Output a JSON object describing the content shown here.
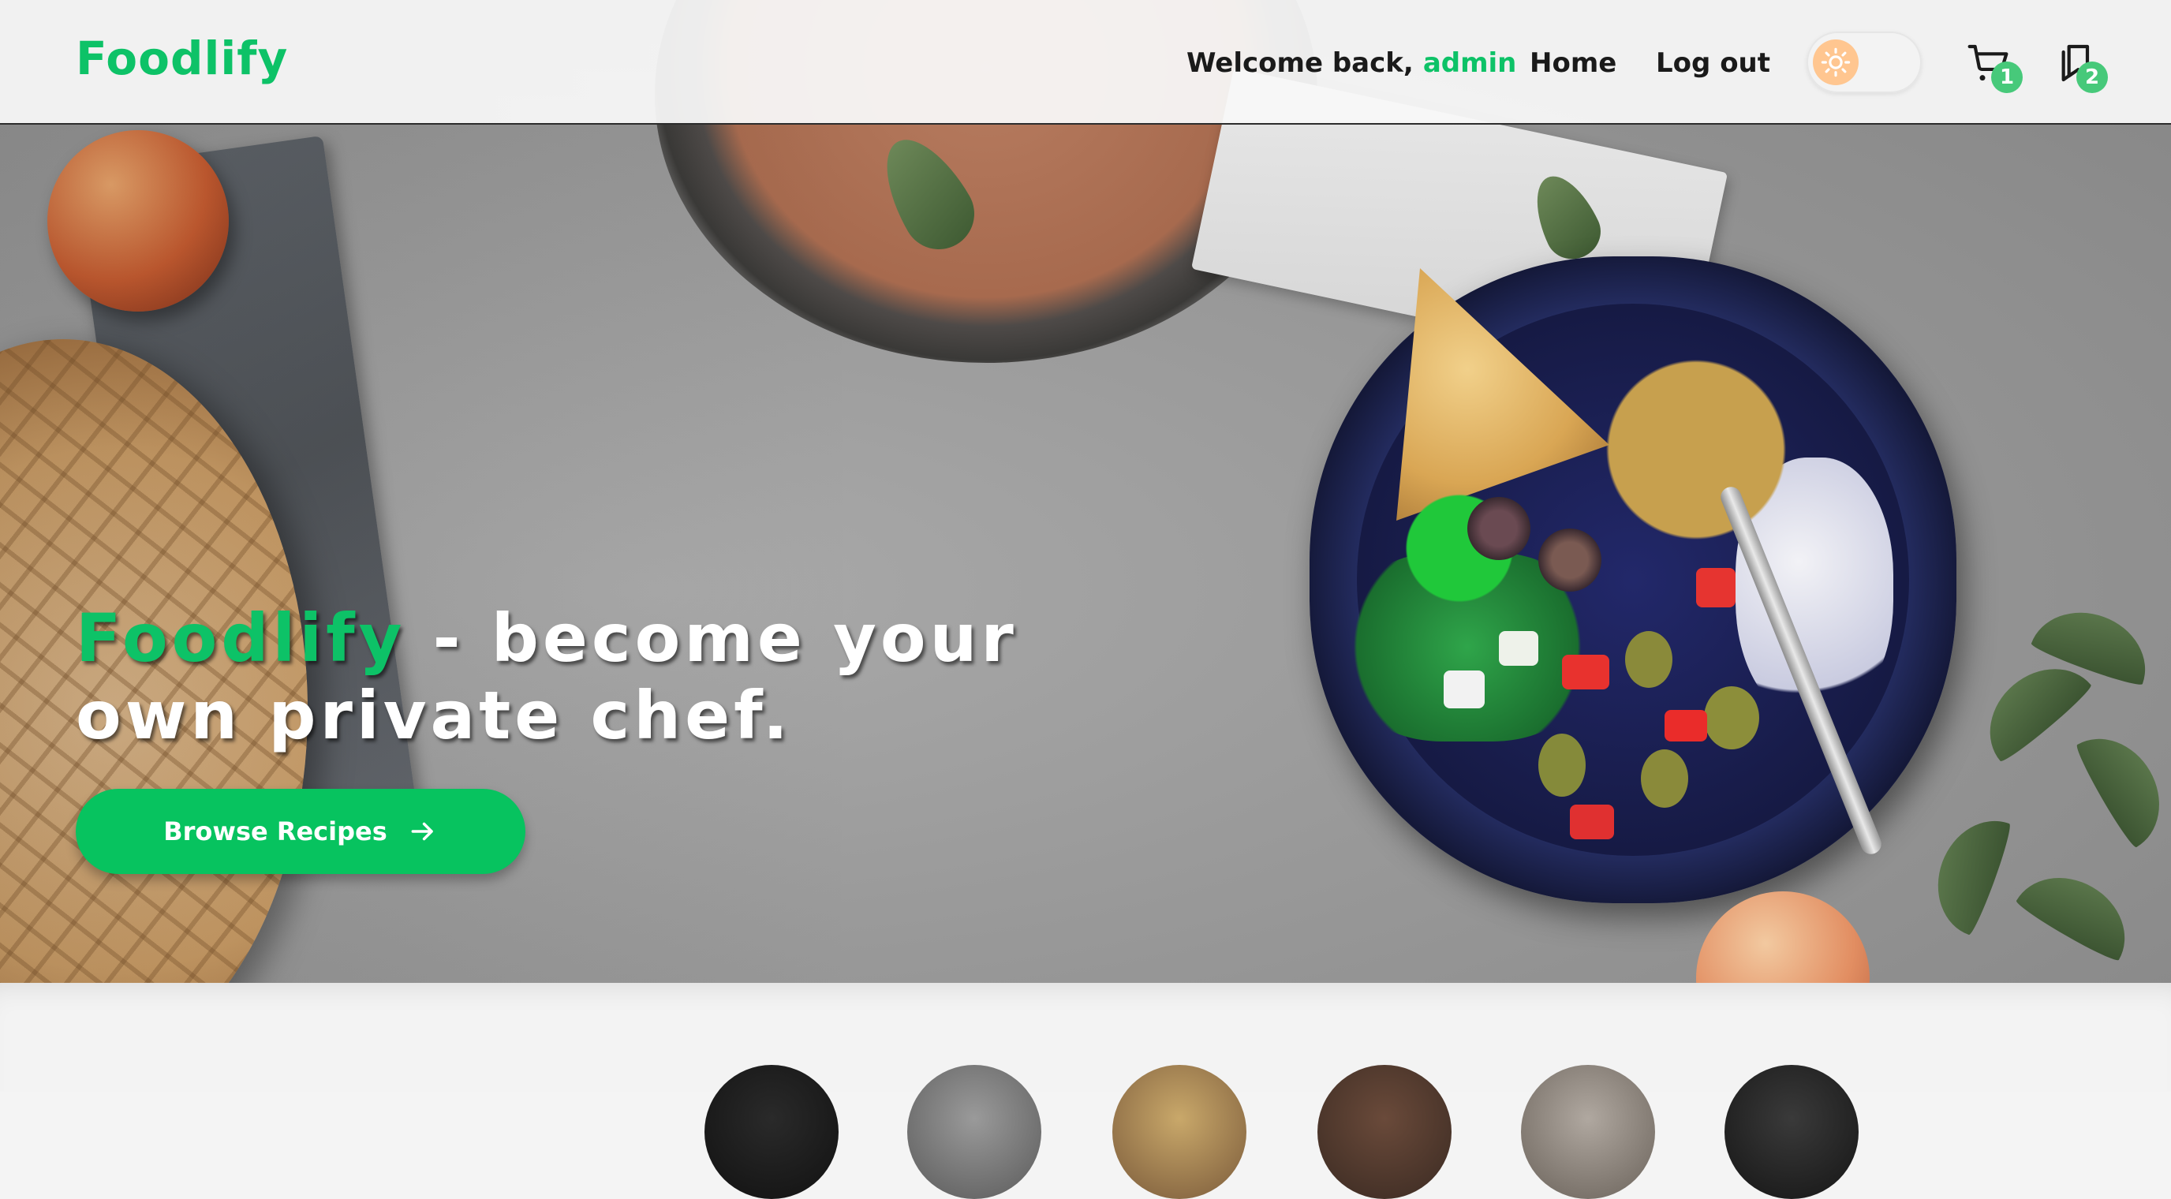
{
  "app": {
    "brand": "Foodlify",
    "accent_color": "#0dc267"
  },
  "header": {
    "welcome_text": "Welcome back,",
    "username": "admin",
    "nav": {
      "home_label": "Home",
      "logout_label": "Log out"
    },
    "theme_toggle": {
      "icon": "sun-icon",
      "state": "light"
    },
    "cart": {
      "icon": "cart-icon",
      "count": "1"
    },
    "saved": {
      "icon": "bookmarks-icon",
      "count": "2"
    }
  },
  "hero": {
    "headline_brand": "Foodlify",
    "headline_rest_line1": " - become your",
    "headline_line2": "own private chef.",
    "cta_label": "Browse Recipes",
    "cta_icon": "arrow-right-icon"
  },
  "categories": {
    "items": [
      {
        "icon": "category-thumb"
      },
      {
        "icon": "category-thumb"
      },
      {
        "icon": "category-thumb"
      },
      {
        "icon": "category-thumb"
      },
      {
        "icon": "category-thumb"
      },
      {
        "icon": "category-thumb"
      }
    ]
  }
}
